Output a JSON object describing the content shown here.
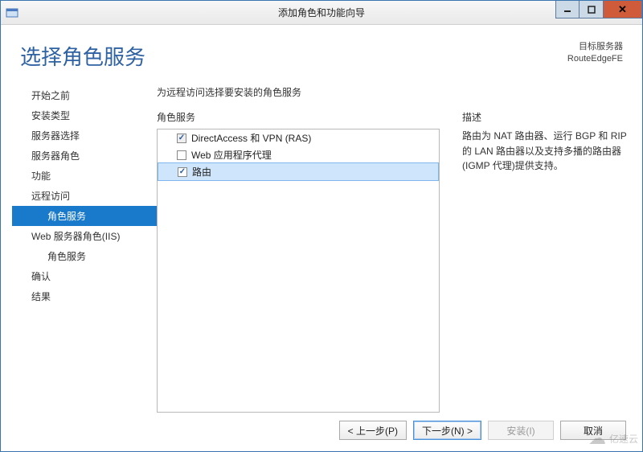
{
  "window": {
    "title": "添加角色和功能向导"
  },
  "header": {
    "page_title": "选择角色服务",
    "target_label": "目标服务器",
    "target_name": "RouteEdgeFE"
  },
  "nav": {
    "items": [
      {
        "label": "开始之前",
        "level": 1,
        "selected": false
      },
      {
        "label": "安装类型",
        "level": 1,
        "selected": false
      },
      {
        "label": "服务器选择",
        "level": 1,
        "selected": false
      },
      {
        "label": "服务器角色",
        "level": 1,
        "selected": false
      },
      {
        "label": "功能",
        "level": 1,
        "selected": false
      },
      {
        "label": "远程访问",
        "level": 1,
        "selected": false
      },
      {
        "label": "角色服务",
        "level": 2,
        "selected": true
      },
      {
        "label": "Web 服务器角色(IIS)",
        "level": 1,
        "selected": false
      },
      {
        "label": "角色服务",
        "level": 2,
        "selected": false
      },
      {
        "label": "确认",
        "level": 1,
        "selected": false
      },
      {
        "label": "结果",
        "level": 1,
        "selected": false
      }
    ]
  },
  "main": {
    "instruction": "为远程访问选择要安装的角色服务",
    "list_title": "角色服务",
    "desc_title": "描述",
    "description": "路由为 NAT 路由器、运行 BGP 和 RIP 的 LAN 路由器以及支持多播的路由器(IGMP 代理)提供支持。",
    "services": [
      {
        "label": "DirectAccess 和 VPN (RAS)",
        "checked": true,
        "disabled": true,
        "selected": false
      },
      {
        "label": "Web 应用程序代理",
        "checked": false,
        "disabled": false,
        "selected": false
      },
      {
        "label": "路由",
        "checked": true,
        "disabled": false,
        "selected": true
      }
    ]
  },
  "footer": {
    "prev": "< 上一步(P)",
    "next": "下一步(N) >",
    "install": "安装(I)",
    "cancel": "取消"
  },
  "watermark": "亿速云"
}
